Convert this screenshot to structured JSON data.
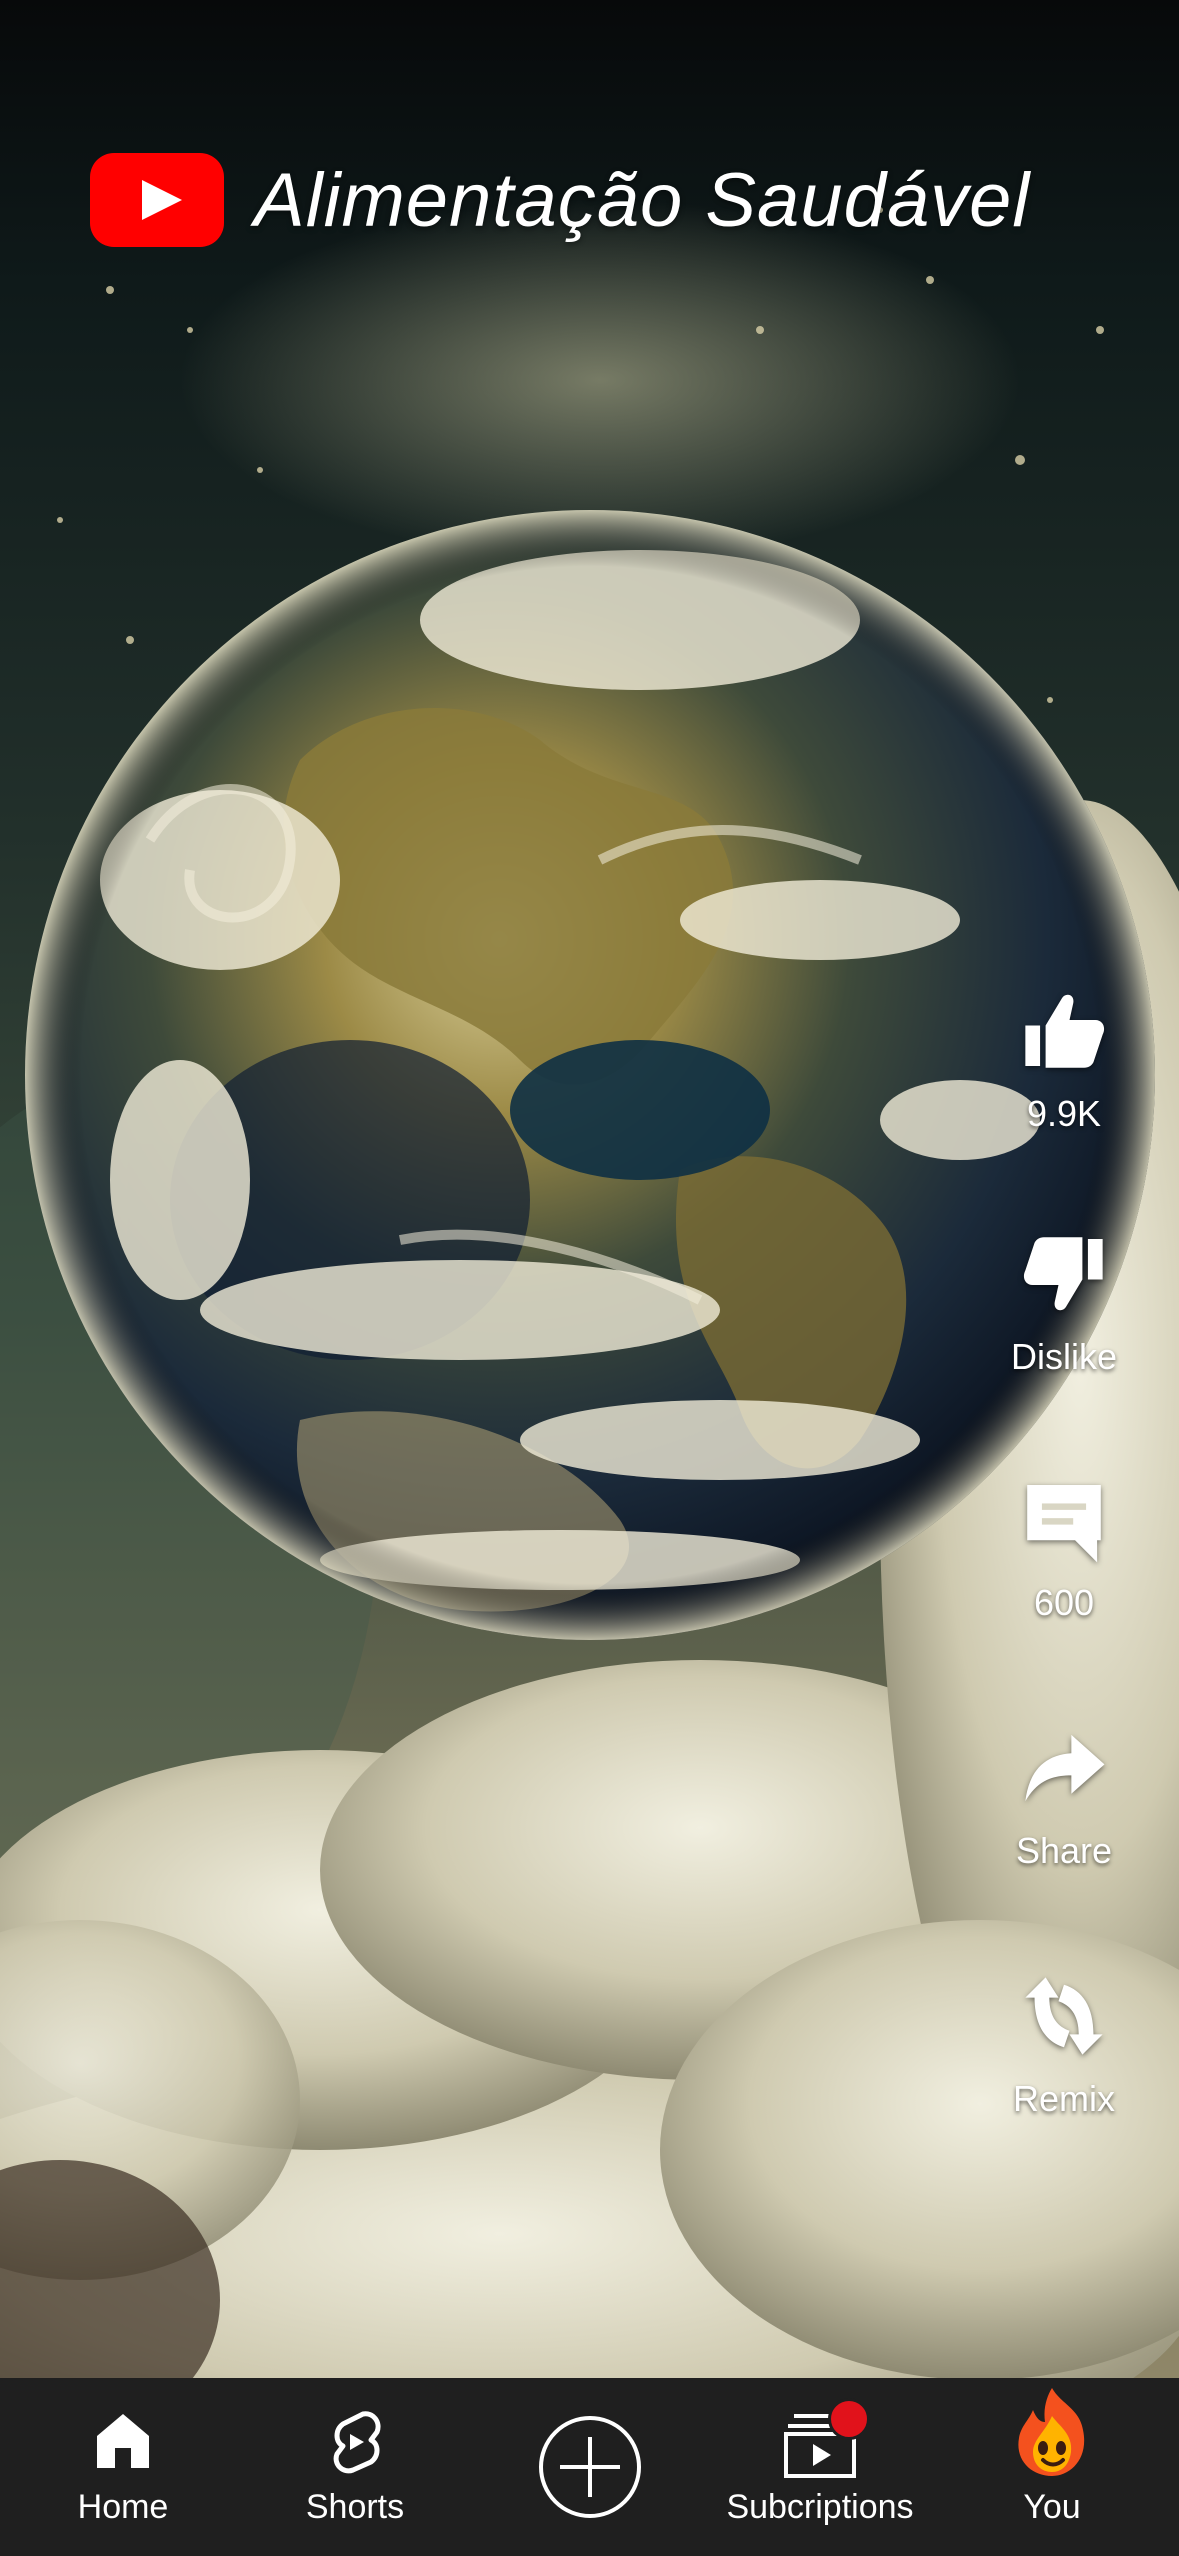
{
  "channel": {
    "name": "Alimentação Saudável",
    "logo_icon": "youtube-play-icon",
    "logo_color": "#ff0000"
  },
  "actions": {
    "like": {
      "label": "9.9K",
      "icon": "thumbs-up-icon"
    },
    "dislike": {
      "label": "Dislike",
      "icon": "thumbs-down-icon"
    },
    "comments": {
      "label": "600",
      "icon": "comment-icon"
    },
    "share": {
      "label": "Share",
      "icon": "share-arrow-icon"
    },
    "remix": {
      "label": "Remix",
      "icon": "remix-icon"
    }
  },
  "nav": {
    "home": {
      "label": "Home",
      "icon": "home-icon"
    },
    "shorts": {
      "label": "Shorts",
      "icon": "shorts-icon"
    },
    "create": {
      "label": "",
      "icon": "plus-circle-icon"
    },
    "subscriptions": {
      "label": "Subcriptions",
      "icon": "subscriptions-icon",
      "badge_color": "#e1121b"
    },
    "you": {
      "label": "You",
      "icon": "fire-avatar-icon"
    }
  },
  "colors": {
    "nav_bg": "#1f1f1f",
    "accent": "#ff0000"
  }
}
